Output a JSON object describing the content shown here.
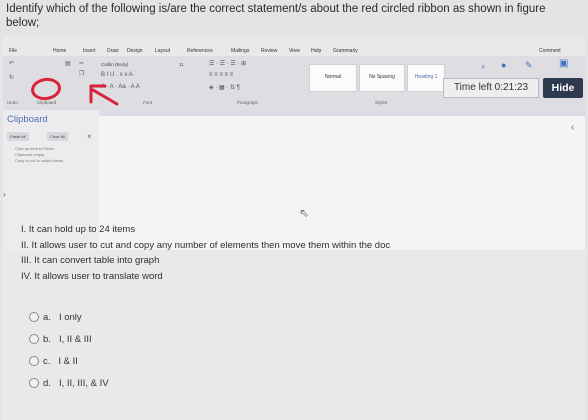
{
  "question": "Identify which of the following is/are the correct statement/s about the red circled ribbon as shown in figure below;",
  "ribbon": {
    "tabs": [
      "File",
      "Home",
      "Insert",
      "Draw",
      "Design",
      "Layout",
      "References",
      "Mailings",
      "Review",
      "View",
      "Help",
      "Grammarly"
    ],
    "comment_label": "Comment",
    "font_name": "Calibri (Body)",
    "font_size": "11",
    "group_labels": [
      "Undo",
      "Clipboard",
      "Font",
      "Paragraph",
      "Styles"
    ],
    "styles": [
      "Normal",
      "No Spacing",
      "Heading 1"
    ]
  },
  "timer": "Time left 0:21:23",
  "hide_label": "Hide",
  "clipboard_pane": {
    "title": "Clipboard",
    "paste_all": "Paste All",
    "clear_all": "Clear All",
    "hint": "Click an item to Paste:",
    "empty": "Clipboard empty.",
    "copy_hint": "Copy or cut to collect items."
  },
  "statements": [
    "I. It can hold up to 24 items",
    "II. It allows user to cut and copy any number of elements then move them within the doc",
    "III. It can convert table into graph",
    "IV. It allows user to translate word"
  ],
  "options": [
    {
      "letter": "a.",
      "text": "I only"
    },
    {
      "letter": "b.",
      "text": "I, II & III"
    },
    {
      "letter": "c.",
      "text": "I & II"
    },
    {
      "letter": "d.",
      "text": "I, II, III, & IV"
    }
  ],
  "colors": {
    "red_circle": "#d8233a",
    "hide_button": "#2e3a4f"
  }
}
